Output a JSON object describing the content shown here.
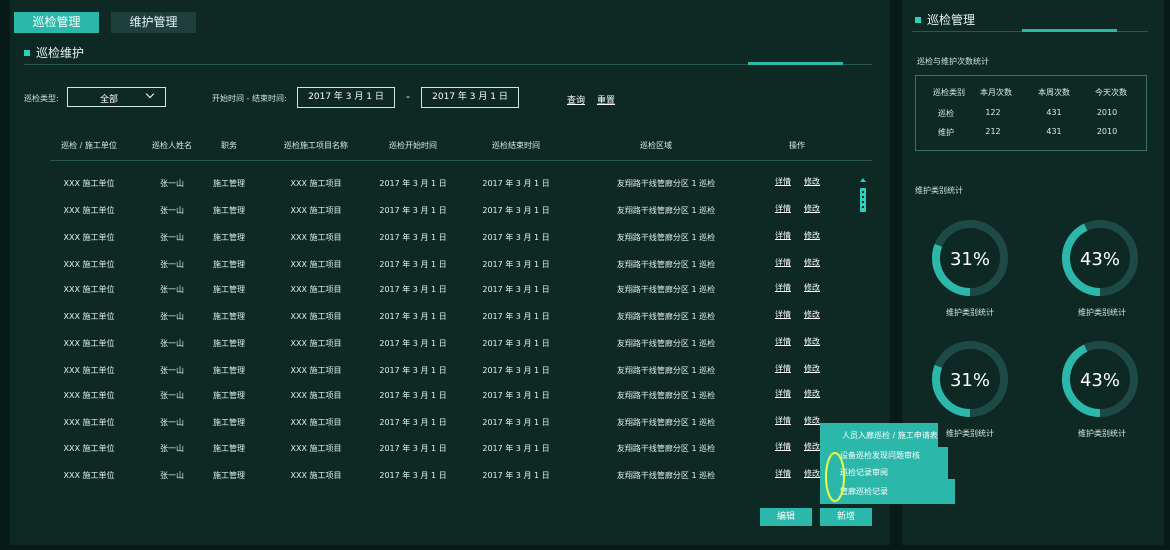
{
  "tabs": [
    {
      "label": "巡检管理",
      "active": true
    },
    {
      "label": "维护管理",
      "active": false
    }
  ],
  "section_title": "巡检维护",
  "filters": {
    "type_label": "巡检类型:",
    "type_value": "全部",
    "time_label": "开始时间 - 结束时间:",
    "start_date": "2017 年 3 月 1 日",
    "end_date": "2017 年 3 月 1 日",
    "dash": "-",
    "query": "查询",
    "reset": "重置"
  },
  "table": {
    "headers": [
      "巡检 / 施工单位",
      "巡检人姓名",
      "职务",
      "巡检施工项目名称",
      "巡检开始时间",
      "巡检结束时间",
      "巡检区域",
      "操作"
    ],
    "rows": [
      [
        "XXX 施工单位",
        "张一山",
        "施工管理",
        "XXX 施工项目",
        "2017 年 3 月 1 日",
        "2017 年 3 月 1 日",
        "友翔路干线管廊分区 1 巡检"
      ],
      [
        "XXX 施工单位",
        "张一山",
        "施工管理",
        "XXX 施工项目",
        "2017 年 3 月 1 日",
        "2017 年 3 月 1 日",
        "友翔路干线管廊分区 1 巡检"
      ],
      [
        "XXX 施工单位",
        "张一山",
        "施工管理",
        "XXX 施工项目",
        "2017 年 3 月 1 日",
        "2017 年 3 月 1 日",
        "友翔路干线管廊分区 1 巡检"
      ],
      [
        "XXX 施工单位",
        "张一山",
        "施工管理",
        "XXX 施工项目",
        "2017 年 3 月 1 日",
        "2017 年 3 月 1 日",
        "友翔路干线管廊分区 1 巡检"
      ],
      [
        "XXX 施工单位",
        "张一山",
        "施工管理",
        "XXX 施工项目",
        "2017 年 3 月 1 日",
        "2017 年 3 月 1 日",
        "友翔路干线管廊分区 1 巡检"
      ],
      [
        "XXX 施工单位",
        "张一山",
        "施工管理",
        "XXX 施工项目",
        "2017 年 3 月 1 日",
        "2017 年 3 月 1 日",
        "友翔路干线管廊分区 1 巡检"
      ],
      [
        "XXX 施工单位",
        "张一山",
        "施工管理",
        "XXX 施工项目",
        "2017 年 3 月 1 日",
        "2017 年 3 月 1 日",
        "友翔路干线管廊分区 1 巡检"
      ],
      [
        "XXX 施工单位",
        "张一山",
        "施工管理",
        "XXX 施工项目",
        "2017 年 3 月 1 日",
        "2017 年 3 月 1 日",
        "友翔路干线管廊分区 1 巡检"
      ],
      [
        "XXX 施工单位",
        "张一山",
        "施工管理",
        "XXX 施工项目",
        "2017 年 3 月 1 日",
        "2017 年 3 月 1 日",
        "友翔路干线管廊分区 1 巡检"
      ],
      [
        "XXX 施工单位",
        "张一山",
        "施工管理",
        "XXX 施工项目",
        "2017 年 3 月 1 日",
        "2017 年 3 月 1 日",
        "友翔路干线管廊分区 1 巡检"
      ],
      [
        "XXX 施工单位",
        "张一山",
        "施工管理",
        "XXX 施工项目",
        "2017 年 3 月 1 日",
        "2017 年 3 月 1 日",
        "友翔路干线管廊分区 1 巡检"
      ],
      [
        "XXX 施工单位",
        "张一山",
        "施工管理",
        "XXX 施工项目",
        "2017 年 3 月 1 日",
        "2017 年 3 月 1 日",
        "友翔路干线管廊分区 1 巡检"
      ]
    ],
    "op_detail": "详情",
    "op_edit": "修改"
  },
  "buttons": {
    "edit": "编辑",
    "add": "新增"
  },
  "right": {
    "title": "巡检管理",
    "stats_title": "巡检与维护次数统计",
    "stats_headers": [
      "巡检类别",
      "本月次数",
      "本周次数",
      "今天次数"
    ],
    "stats_rows": [
      [
        "巡检",
        "122",
        "431",
        "2010"
      ],
      [
        "维护",
        "212",
        "431",
        "2010"
      ]
    ],
    "maint_title": "维护类别统计",
    "donuts": [
      {
        "percent": 31,
        "text": "31%",
        "label": "维护类别统计"
      },
      {
        "percent": 43,
        "text": "43%",
        "label": "维护类别统计"
      },
      {
        "percent": 31,
        "text": "31%",
        "label": "维护类别统计"
      },
      {
        "percent": 43,
        "text": "43%",
        "label": "维护类别统计"
      }
    ]
  },
  "popup": {
    "items": [
      "人员入廊巡检 / 施工申请表",
      "设备巡检发现问题审核",
      "巡检记录审阅",
      "管廊巡检记录"
    ]
  },
  "colors": {
    "accent": "#2bb8aa",
    "panel": "#0e2824",
    "background": "#081a17",
    "donut_track": "#1e4a45"
  }
}
